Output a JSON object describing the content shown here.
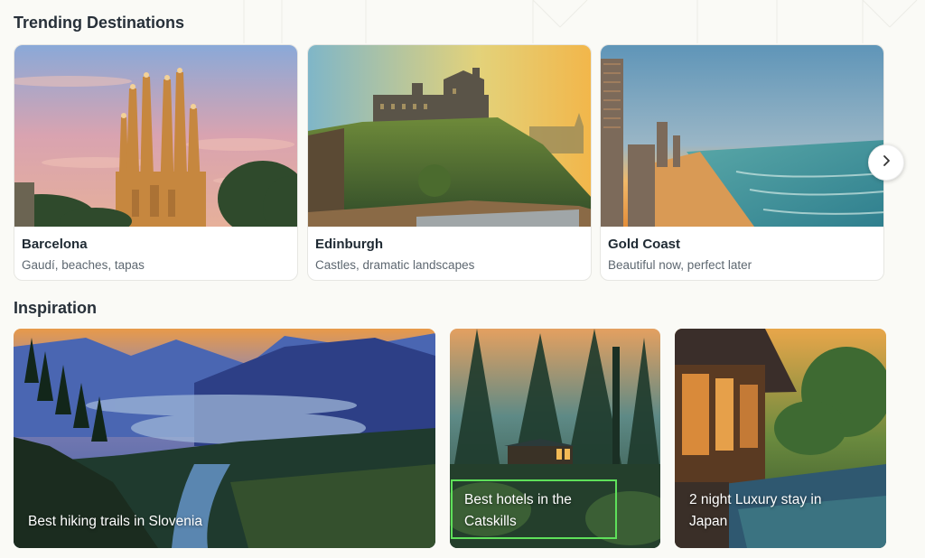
{
  "trending": {
    "title": "Trending Destinations",
    "cards": [
      {
        "name": "Barcelona",
        "desc": "Gaudí, beaches, tapas"
      },
      {
        "name": "Edinburgh",
        "desc": "Castles, dramatic landscapes"
      },
      {
        "name": "Gold Coast",
        "desc": "Beautiful now, perfect later"
      }
    ],
    "next_icon": "chevron-right-icon"
  },
  "inspiration": {
    "title": "Inspiration",
    "cards": [
      {
        "label": "Best hiking trails in Slovenia"
      },
      {
        "label_line1": "Best hotels in the",
        "label_line2": "Catskills"
      },
      {
        "label_line1": "2 night Luxury stay in",
        "label_line2": "Japan"
      }
    ]
  },
  "colors": {
    "highlight": "#5ee05a",
    "page_bg": "#fafaf6"
  }
}
